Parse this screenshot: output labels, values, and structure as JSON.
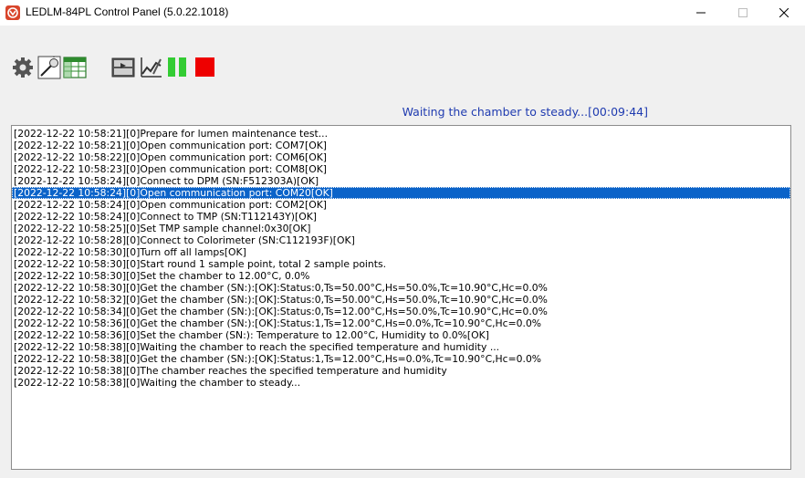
{
  "window": {
    "title": "LEDLM-84PL Control Panel (5.0.22.1018)"
  },
  "toolbar": {
    "buttons": [
      {
        "name": "settings",
        "icon": "gear-icon"
      },
      {
        "name": "lamp-setup",
        "icon": "lamp-icon"
      },
      {
        "name": "table",
        "icon": "spreadsheet-icon"
      },
      {
        "name": "video",
        "icon": "film-icon"
      },
      {
        "name": "chart",
        "icon": "chart-icon"
      },
      {
        "name": "pause",
        "icon": "pause-icon"
      },
      {
        "name": "stop",
        "icon": "stop-icon"
      }
    ]
  },
  "status": {
    "text": "Waiting the chamber to steady...[00:09:44]"
  },
  "log": {
    "selected_index": 5,
    "lines": [
      "[2022-12-22 10:58:21][0]Prepare for lumen maintenance test...",
      "[2022-12-22 10:58:21][0]Open communication port: COM7[OK]",
      "[2022-12-22 10:58:22][0]Open communication port: COM6[OK]",
      "[2022-12-22 10:58:23][0]Open communication port: COM8[OK]",
      "[2022-12-22 10:58:24][0]Connect to DPM (SN:F512303A)[OK]",
      "[2022-12-22 10:58:24][0]Open communication port: COM20[OK]",
      "[2022-12-22 10:58:24][0]Open communication port: COM2[OK]",
      "[2022-12-22 10:58:24][0]Connect to TMP (SN:T112143Y)[OK]",
      "[2022-12-22 10:58:25][0]Set TMP sample channel:0x30[OK]",
      "[2022-12-22 10:58:28][0]Connect to Colorimeter (SN:C112193F)[OK]",
      "[2022-12-22 10:58:30][0]Turn off all lamps[OK]",
      "[2022-12-22 10:58:30][0]Start round 1 sample point, total 2 sample points.",
      "[2022-12-22 10:58:30][0]Set the chamber to 12.00°C, 0.0%",
      "[2022-12-22 10:58:30][0]Get the chamber (SN:):[OK]:Status:0,Ts=50.00°C,Hs=50.0%,Tc=10.90°C,Hc=0.0%",
      "[2022-12-22 10:58:32][0]Get the chamber (SN:):[OK]:Status:0,Ts=50.00°C,Hs=50.0%,Tc=10.90°C,Hc=0.0%",
      "[2022-12-22 10:58:34][0]Get the chamber (SN:):[OK]:Status:0,Ts=12.00°C,Hs=50.0%,Tc=10.90°C,Hc=0.0%",
      "[2022-12-22 10:58:36][0]Get the chamber (SN:):[OK]:Status:1,Ts=12.00°C,Hs=0.0%,Tc=10.90°C,Hc=0.0%",
      "[2022-12-22 10:58:36][0]Set the chamber (SN:): Temperature to 12.00°C, Humidity to 0.0%[OK]",
      "[2022-12-22 10:58:38][0]Waiting the chamber to reach the specified temperature and humidity ...",
      "[2022-12-22 10:58:38][0]Get the chamber (SN:):[OK]:Status:1,Ts=12.00°C,Hs=0.0%,Tc=10.90°C,Hc=0.0%",
      "[2022-12-22 10:58:38][0]The chamber reaches the specified temperature and humidity",
      "[2022-12-22 10:58:38][0]Waiting the chamber to steady..."
    ]
  },
  "colors": {
    "status_text": "#1f3bb0",
    "selection": "#0b63c9",
    "pause": "#33cc33",
    "stop": "#ee0000"
  }
}
